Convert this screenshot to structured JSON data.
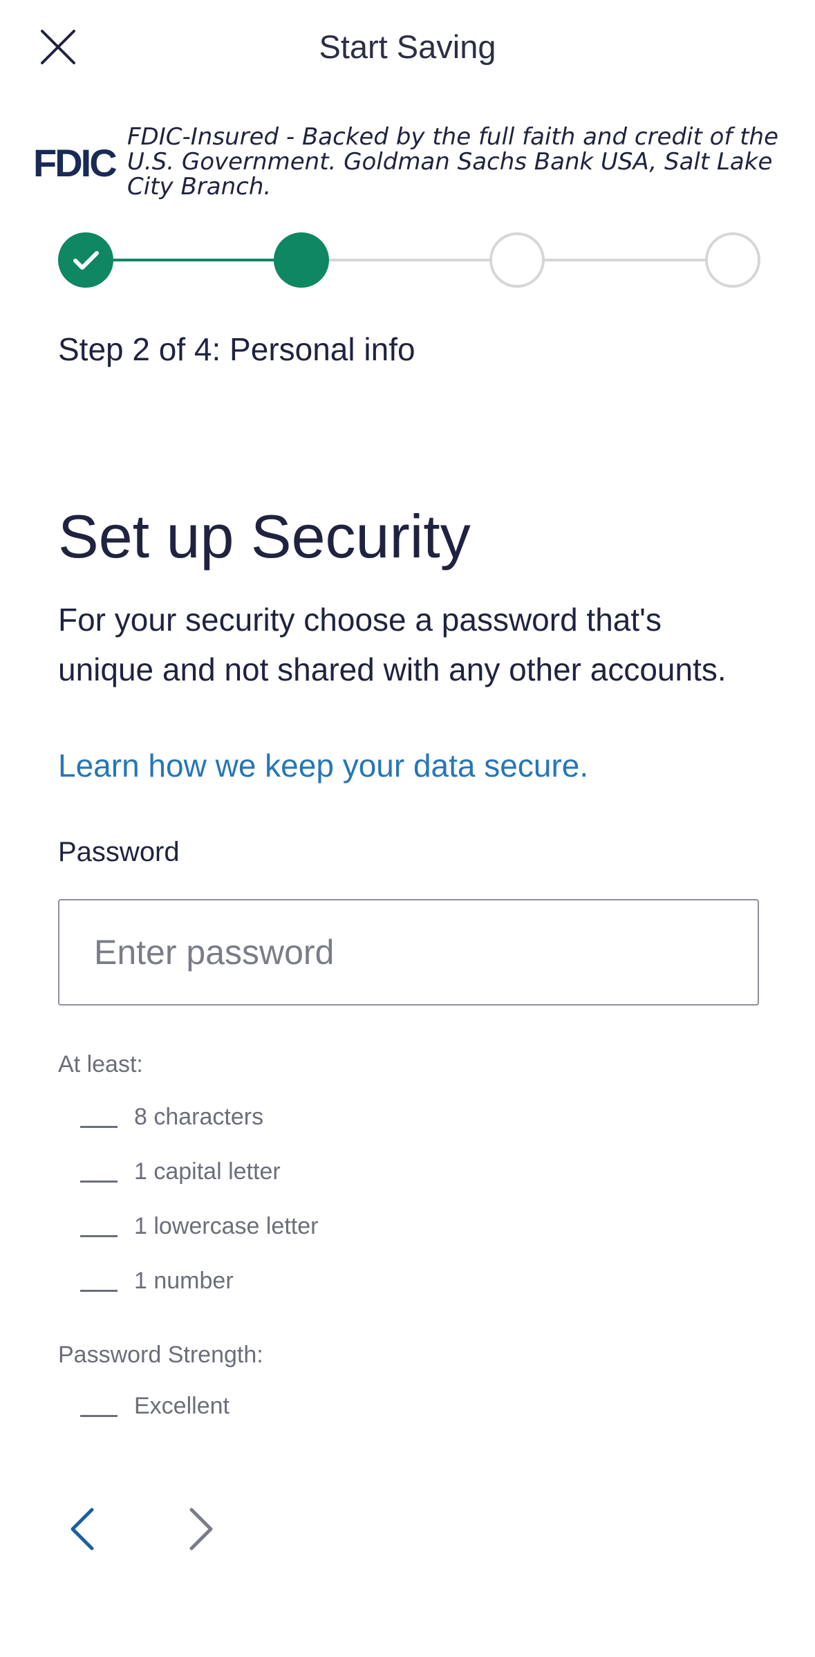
{
  "header": {
    "title": "Start Saving",
    "close_icon": "close-icon"
  },
  "fdic": {
    "logo_text": "FDIC",
    "text": "FDIC-Insured - Backed by the full faith and credit of the U.S. Government. Goldman Sachs Bank USA, Salt Lake City Branch."
  },
  "stepper": {
    "label": "Step 2 of 4: Personal info",
    "current": 2,
    "total": 4,
    "active_color": "#0e8762",
    "inactive_color": "#d6d6d6"
  },
  "main": {
    "title": "Set up Security",
    "description": "For your security choose a password that's unique and not shared with any other accounts.",
    "link": "Learn how we keep your data secure."
  },
  "password": {
    "label": "Password",
    "placeholder": "Enter password",
    "value": ""
  },
  "requirements": {
    "heading": "At least:",
    "items": [
      {
        "label": "8 characters"
      },
      {
        "label": "1 capital letter"
      },
      {
        "label": "1 lowercase letter"
      },
      {
        "label": "1 number"
      }
    ]
  },
  "strength": {
    "heading": "Password Strength:",
    "value": "Excellent"
  },
  "nav": {
    "back_icon": "chevron-left-icon",
    "next_icon": "chevron-right-icon",
    "back_color": "#1a5fa0",
    "next_color": "#7a7d88"
  }
}
